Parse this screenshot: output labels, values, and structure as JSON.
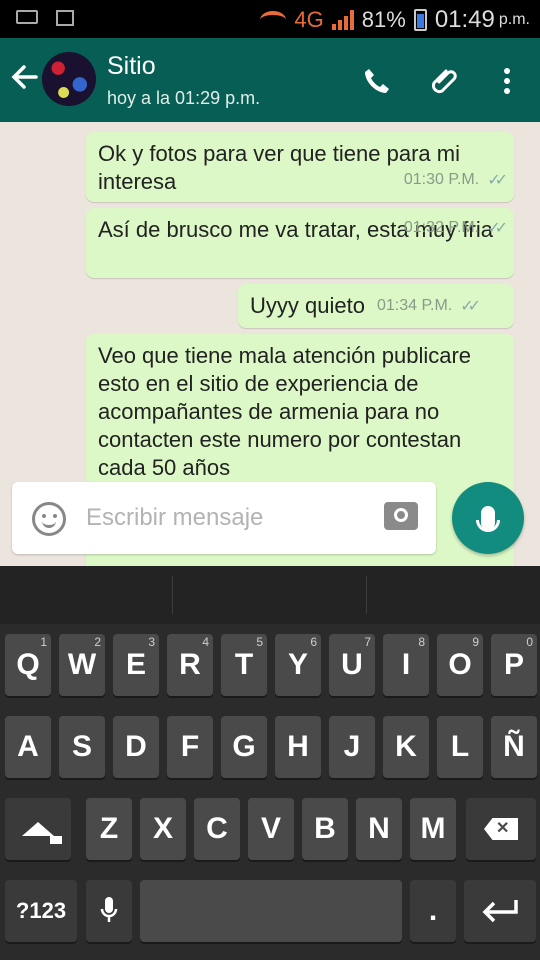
{
  "status_bar": {
    "network": "4G",
    "battery": "81%",
    "time": "01:49",
    "period": "p.m."
  },
  "header": {
    "contact_name": "Sitio",
    "last_seen": "hoy a la 01:29 p.m.",
    "icons": [
      "back-arrow-icon",
      "phone-icon",
      "attach-icon",
      "more-icon"
    ]
  },
  "messages": [
    {
      "text": "Ok y fotos para ver que tiene para mi interesa",
      "time": "01:30 P.M.",
      "status": "read"
    },
    {
      "text": "Así de brusco me va tratar, esta muy fria",
      "time": "01:32 P.M.",
      "status": "read"
    },
    {
      "text": "Uyyy quieto",
      "time": "01:34 P.M.",
      "status": "read"
    },
    {
      "text": "Veo que tiene mala atención publicare esto en el sitio de experiencia de acompañantes de armenia para no contacten este numero por contestan cada 50  años",
      "time": "",
      "status": ""
    }
  ],
  "composer": {
    "placeholder": "Escribir mensaje"
  },
  "keyboard": {
    "row1": [
      {
        "label": "Q",
        "hint": "1"
      },
      {
        "label": "W",
        "hint": "2"
      },
      {
        "label": "E",
        "hint": "3"
      },
      {
        "label": "R",
        "hint": "4"
      },
      {
        "label": "T",
        "hint": "5"
      },
      {
        "label": "Y",
        "hint": "6"
      },
      {
        "label": "U",
        "hint": "7"
      },
      {
        "label": "I",
        "hint": "8"
      },
      {
        "label": "O",
        "hint": "9"
      },
      {
        "label": "P",
        "hint": "0"
      }
    ],
    "row2": [
      "A",
      "S",
      "D",
      "F",
      "G",
      "H",
      "J",
      "K",
      "L",
      "Ñ"
    ],
    "row3": [
      "Z",
      "X",
      "C",
      "V",
      "B",
      "N",
      "M"
    ],
    "symbols_label": "?123",
    "period_label": "."
  },
  "colors": {
    "header": "#075e54",
    "outgoing_bubble": "#dcf8c6",
    "mic_button": "#128c7e",
    "network_accent": "#e86b3a"
  }
}
